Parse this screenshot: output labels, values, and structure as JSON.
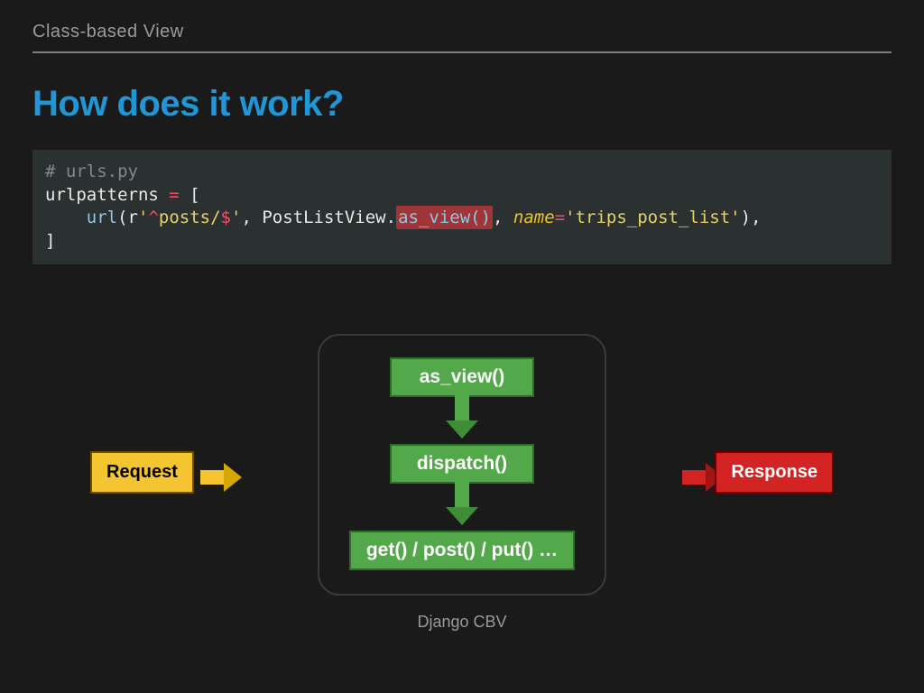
{
  "header": {
    "section": "Class-based View"
  },
  "title": "How does it work?",
  "code": {
    "comment": "# urls.py",
    "lhs": "urlpatterns",
    "eq": " = ",
    "lb": "[",
    "indent": "    ",
    "url_fn": "url",
    "lp": "(",
    "r_prefix": "r",
    "regex_open": "'",
    "regex_caret": "^",
    "regex_body": "posts/",
    "regex_dollar": "$",
    "regex_close": "'",
    "comma1": ", ",
    "view_cls": "PostListView",
    "dot": ".",
    "as_view": "as_view()",
    "comma2": ", ",
    "name_kw": "name",
    "name_eq": "=",
    "name_val": "'trips_post_list'",
    "rp": ")",
    "trailing": ",",
    "rb": "]"
  },
  "flow": {
    "container_label": "Django CBV",
    "steps": [
      "as_view()",
      "dispatch()",
      "get() / post() / put() …"
    ]
  },
  "io": {
    "request": "Request",
    "response": "Response"
  },
  "colors": {
    "bg": "#1a1a1a",
    "accent_blue": "#2196d6",
    "code_bg": "#2b3030",
    "green": "#53a94a",
    "yellow": "#f4c530",
    "red": "#d42323",
    "border_dark": "#3a3a3a"
  }
}
